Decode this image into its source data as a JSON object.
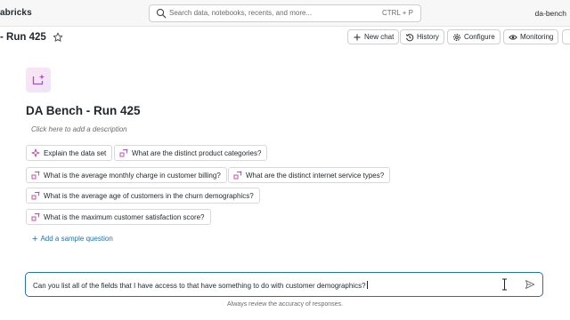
{
  "topbar": {
    "brand": "abricks",
    "search_placeholder": "Search data, notebooks, recents, and more...",
    "search_shortcut": "CTRL + P",
    "workspace": "da-bench"
  },
  "header": {
    "title": "- Run 425",
    "buttons": {
      "new_chat": "New chat",
      "history": "History",
      "configure": "Configure",
      "monitoring": "Monitoring"
    }
  },
  "space": {
    "title": "DA Bench - Run 425",
    "description_placeholder": "Click here to add a description"
  },
  "sample_questions": [
    "Explain the data set",
    "What are the distinct product categories?",
    "What is the average monthly charge in customer billing?",
    "What are the distinct internet service types?",
    "What is the average age of customers in the churn demographics?",
    "What is the maximum customer satisfaction score?"
  ],
  "add_sample": "Add a sample question",
  "chat": {
    "input_value": "Can you list all of the fields that I have access to that have something to do with customer demographics?",
    "footer": "Always review the accuracy of responses."
  },
  "colors": {
    "accent": "#2272b4",
    "genie_pink": "#d63ca0",
    "genie_purple": "#8c5cd6"
  },
  "icons": {
    "search": "search-icon",
    "star": "star-icon",
    "sparkle": "sparkle-icon",
    "question": "sample-question-icon",
    "send": "send-icon"
  }
}
